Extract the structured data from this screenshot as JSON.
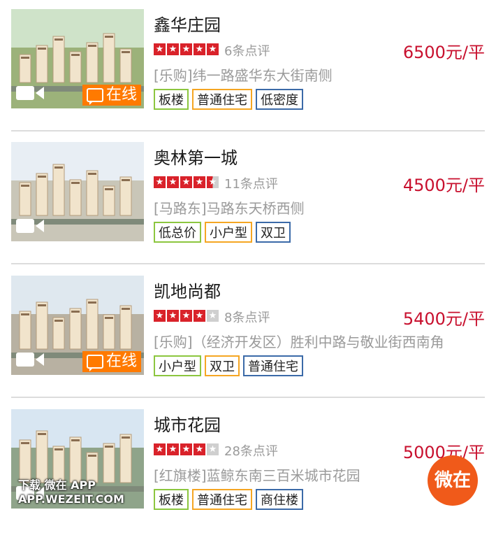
{
  "listings": [
    {
      "title": "鑫华庄园",
      "rating_stars": 5,
      "reviews": "6条点评",
      "price": "6500元/平",
      "address": "[乐购]纬一路盛华东大街南侧",
      "online_label": "在线",
      "show_online": true,
      "tags": [
        {
          "label": "板楼",
          "color": "green"
        },
        {
          "label": "普通住宅",
          "color": "orange"
        },
        {
          "label": "低密度",
          "color": "blue"
        }
      ]
    },
    {
      "title": "奥林第一城",
      "rating_stars": 4.5,
      "reviews": "11条点评",
      "price": "4500元/平",
      "address": "[马路东]马路东天桥西侧",
      "online_label": "",
      "show_online": false,
      "tags": [
        {
          "label": "低总价",
          "color": "green"
        },
        {
          "label": "小户型",
          "color": "orange"
        },
        {
          "label": "双卫",
          "color": "blue"
        }
      ]
    },
    {
      "title": "凯地尚都",
      "rating_stars": 4,
      "reviews": "8条点评",
      "price": "5400元/平",
      "address": "[乐购]（经济开发区）胜利中路与敬业街西南角",
      "online_label": "在线",
      "show_online": true,
      "tags": [
        {
          "label": "小户型",
          "color": "green"
        },
        {
          "label": "双卫",
          "color": "orange"
        },
        {
          "label": "普通住宅",
          "color": "blue"
        }
      ]
    },
    {
      "title": "城市花园",
      "rating_stars": 4,
      "reviews": "28条点评",
      "price": "5000元/平",
      "address": "[红旗楼]蓝鲸东南三百米城市花园",
      "online_label": "",
      "show_online": false,
      "tags": [
        {
          "label": "板楼",
          "color": "green"
        },
        {
          "label": "普通住宅",
          "color": "orange"
        },
        {
          "label": "商住楼",
          "color": "blue"
        }
      ]
    }
  ],
  "icons": {
    "video": "video-camera-icon",
    "chat": "chat-bubble-icon",
    "star": "star-icon"
  },
  "colors": {
    "price": "#c8102e",
    "star": "#d9222a",
    "online_badge": "#ff7a00",
    "tag_green": "#8cc63f",
    "tag_orange": "#f5a623",
    "tag_blue": "#3b6aa8"
  },
  "watermark": {
    "line1": "下载 微在 APP",
    "line2": "APP.WEZEIT.COM",
    "badge": "微在"
  }
}
